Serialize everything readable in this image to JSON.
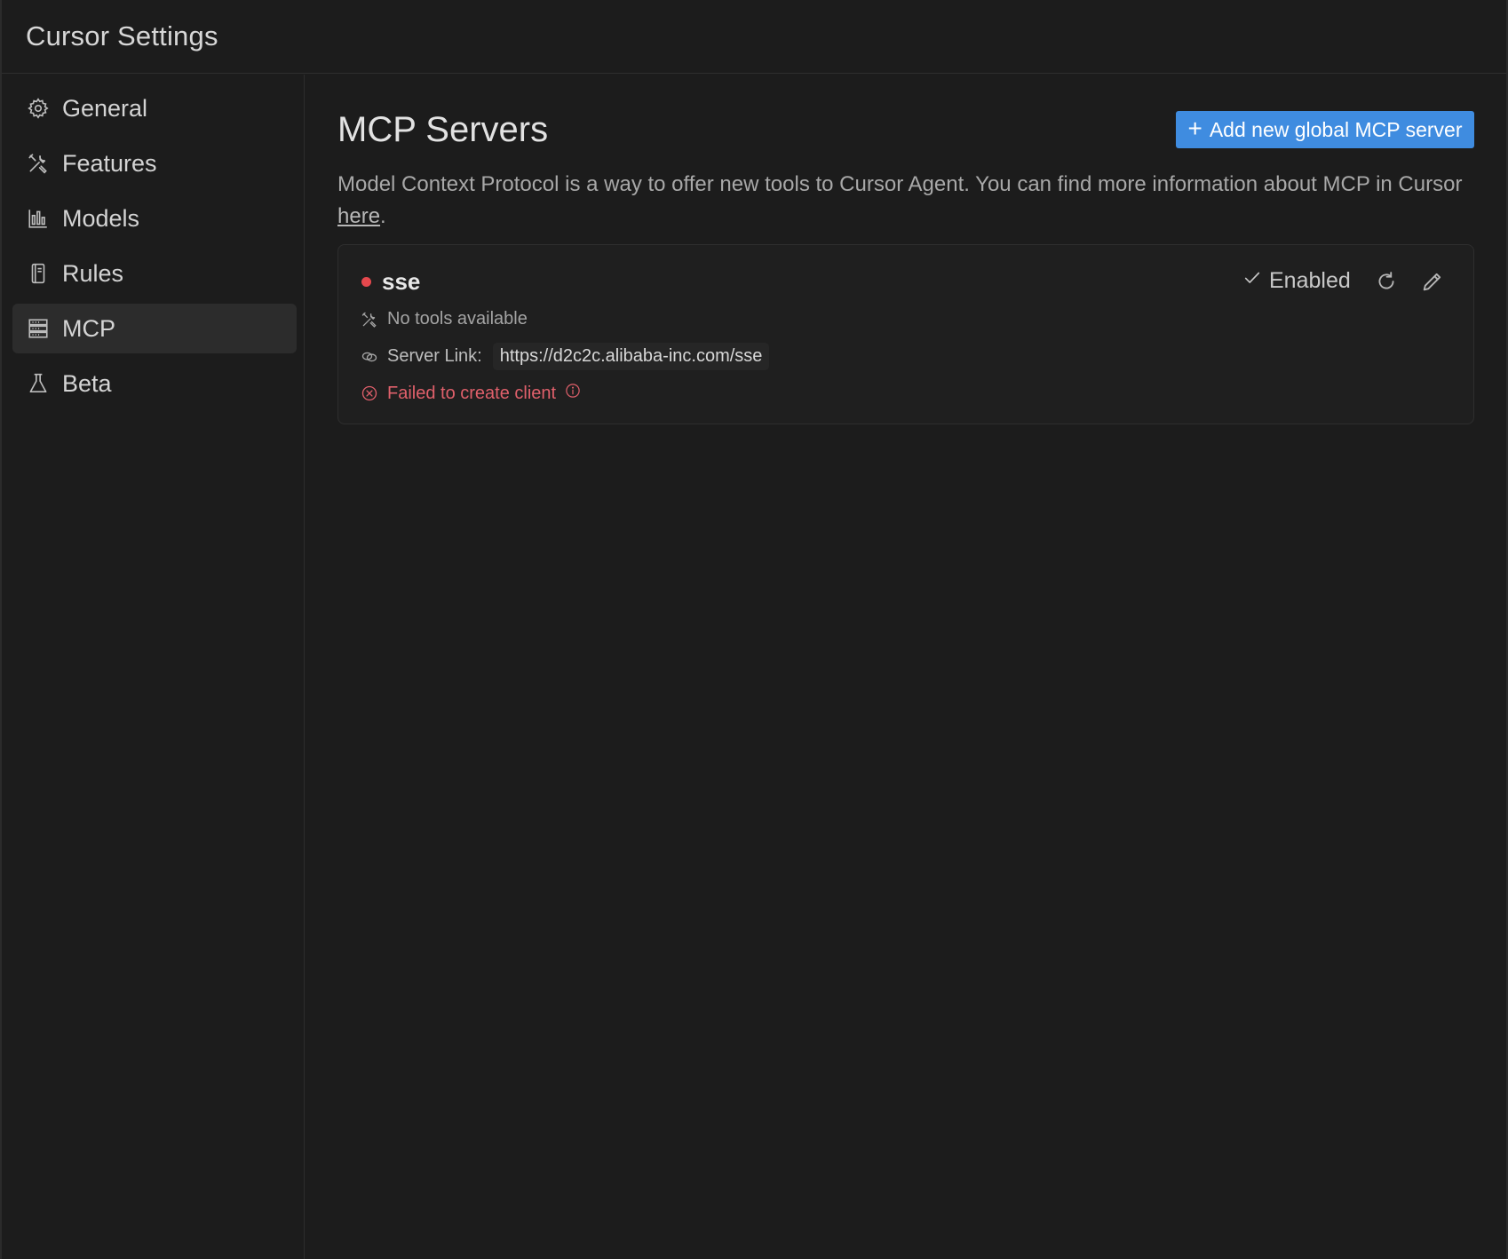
{
  "window": {
    "title": "Cursor Settings"
  },
  "sidebar": {
    "items": [
      {
        "label": "General",
        "icon": "gear-icon"
      },
      {
        "label": "Features",
        "icon": "tools-icon"
      },
      {
        "label": "Models",
        "icon": "bar-chart-icon"
      },
      {
        "label": "Rules",
        "icon": "book-icon"
      },
      {
        "label": "MCP",
        "icon": "server-icon",
        "active": true
      },
      {
        "label": "Beta",
        "icon": "flask-icon"
      }
    ]
  },
  "main": {
    "title": "MCP Servers",
    "add_button": "Add new global MCP server",
    "description_prefix": "Model Context Protocol is a way to offer new tools to Cursor Agent. You can find more information about MCP in Cursor ",
    "description_link": "here",
    "description_suffix": "."
  },
  "server": {
    "name": "sse",
    "status_color": "#e5484d",
    "enabled_label": "Enabled",
    "tools_text": "No tools available",
    "link_label": "Server Link:",
    "url": "https://d2c2c.alibaba-inc.com/sse",
    "error_text": "Failed to create client"
  },
  "colors": {
    "accent": "#3f8ce0",
    "error": "#e0606b",
    "background": "#1c1c1c"
  }
}
